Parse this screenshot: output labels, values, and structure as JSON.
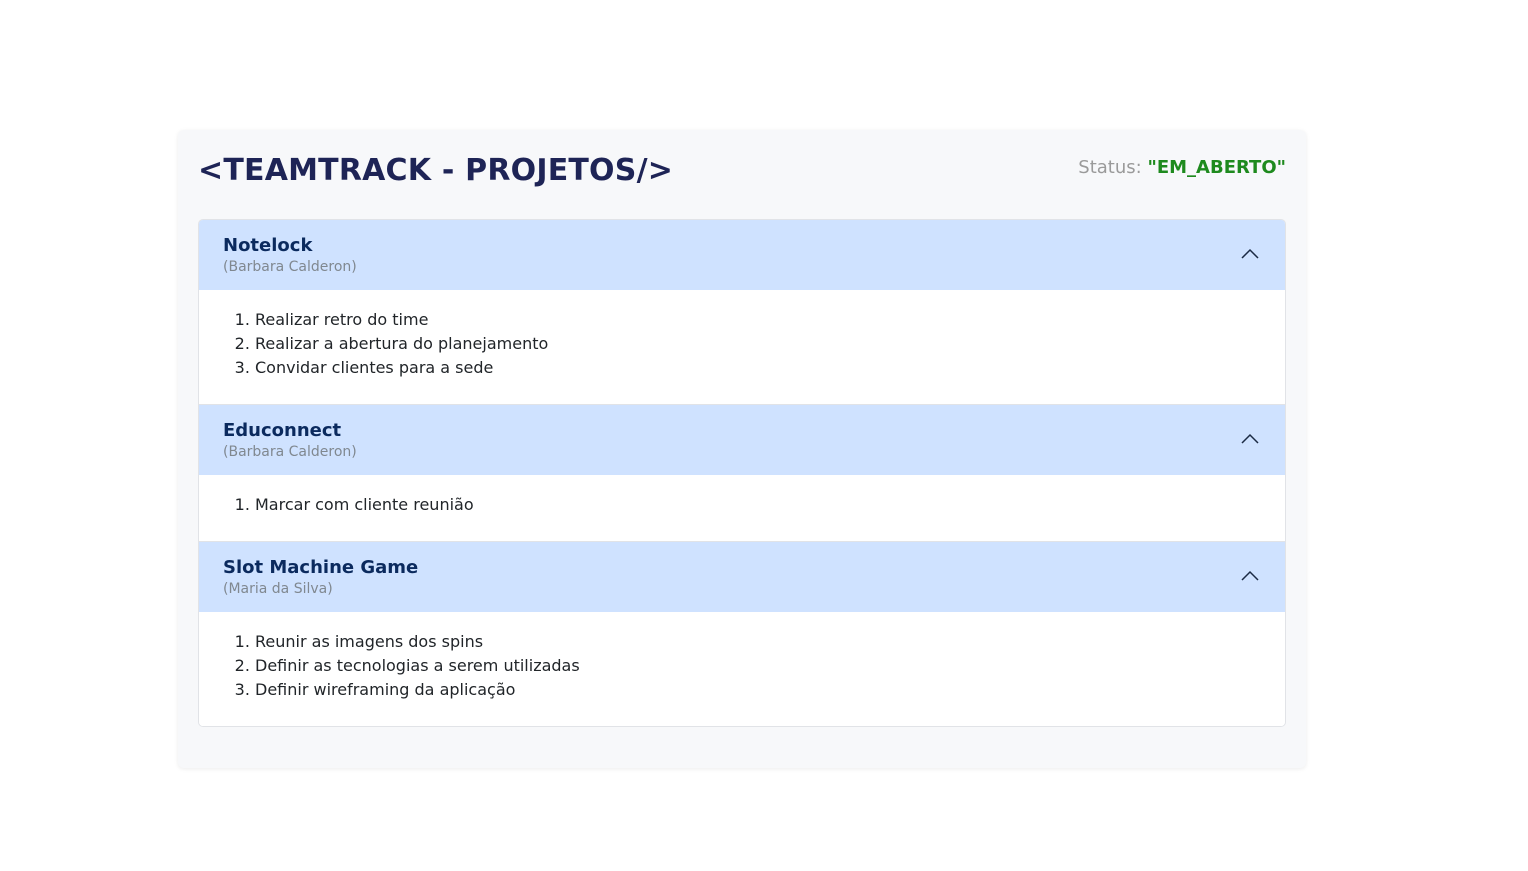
{
  "header": {
    "title": "<TEAMTRACK - PROJETOS/>",
    "status_label": "Status: ",
    "status_value": "\"EM_ABERTO\""
  },
  "icons": {
    "toggle": "chevron-up-icon"
  },
  "colors": {
    "title": "#1e2456",
    "status_value": "#1e8a1e",
    "accordion_header_bg": "#cfe2ff",
    "project_title": "#0b2a5e"
  },
  "projects": [
    {
      "name": "Notelock",
      "owner": "(Barbara Calderon)",
      "tasks": [
        "Realizar retro do time",
        "Realizar a abertura do planejamento",
        "Convidar clientes para a sede"
      ]
    },
    {
      "name": "Educonnect",
      "owner": "(Barbara Calderon)",
      "tasks": [
        "Marcar com cliente reunião"
      ]
    },
    {
      "name": "Slot Machine Game",
      "owner": "(Maria da Silva)",
      "tasks": [
        "Reunir as imagens dos spins",
        "Definir as tecnologias a serem utilizadas",
        "Definir wireframing da aplicação"
      ]
    }
  ]
}
